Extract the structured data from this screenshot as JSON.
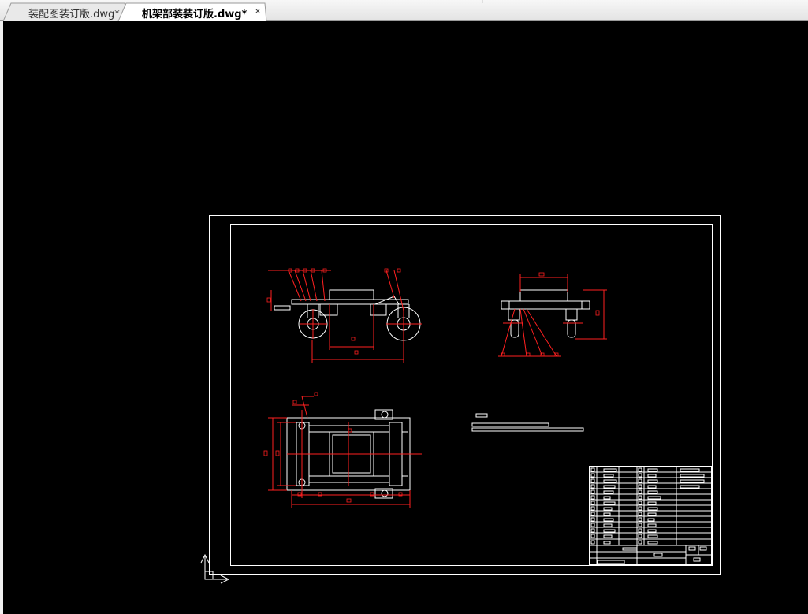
{
  "tabs": [
    {
      "label": "装配图装订版.dwg*",
      "active": false
    },
    {
      "label": "机架部装装订版.dwg*",
      "active": true
    }
  ],
  "close_glyph": "×",
  "colors": {
    "canvas_bg": "#000000",
    "drawing_white": "#ffffff",
    "dimension_red": "#ff2020"
  },
  "icons": {
    "tab_close": "close-icon",
    "ucs": "ucs-axis-icon"
  }
}
